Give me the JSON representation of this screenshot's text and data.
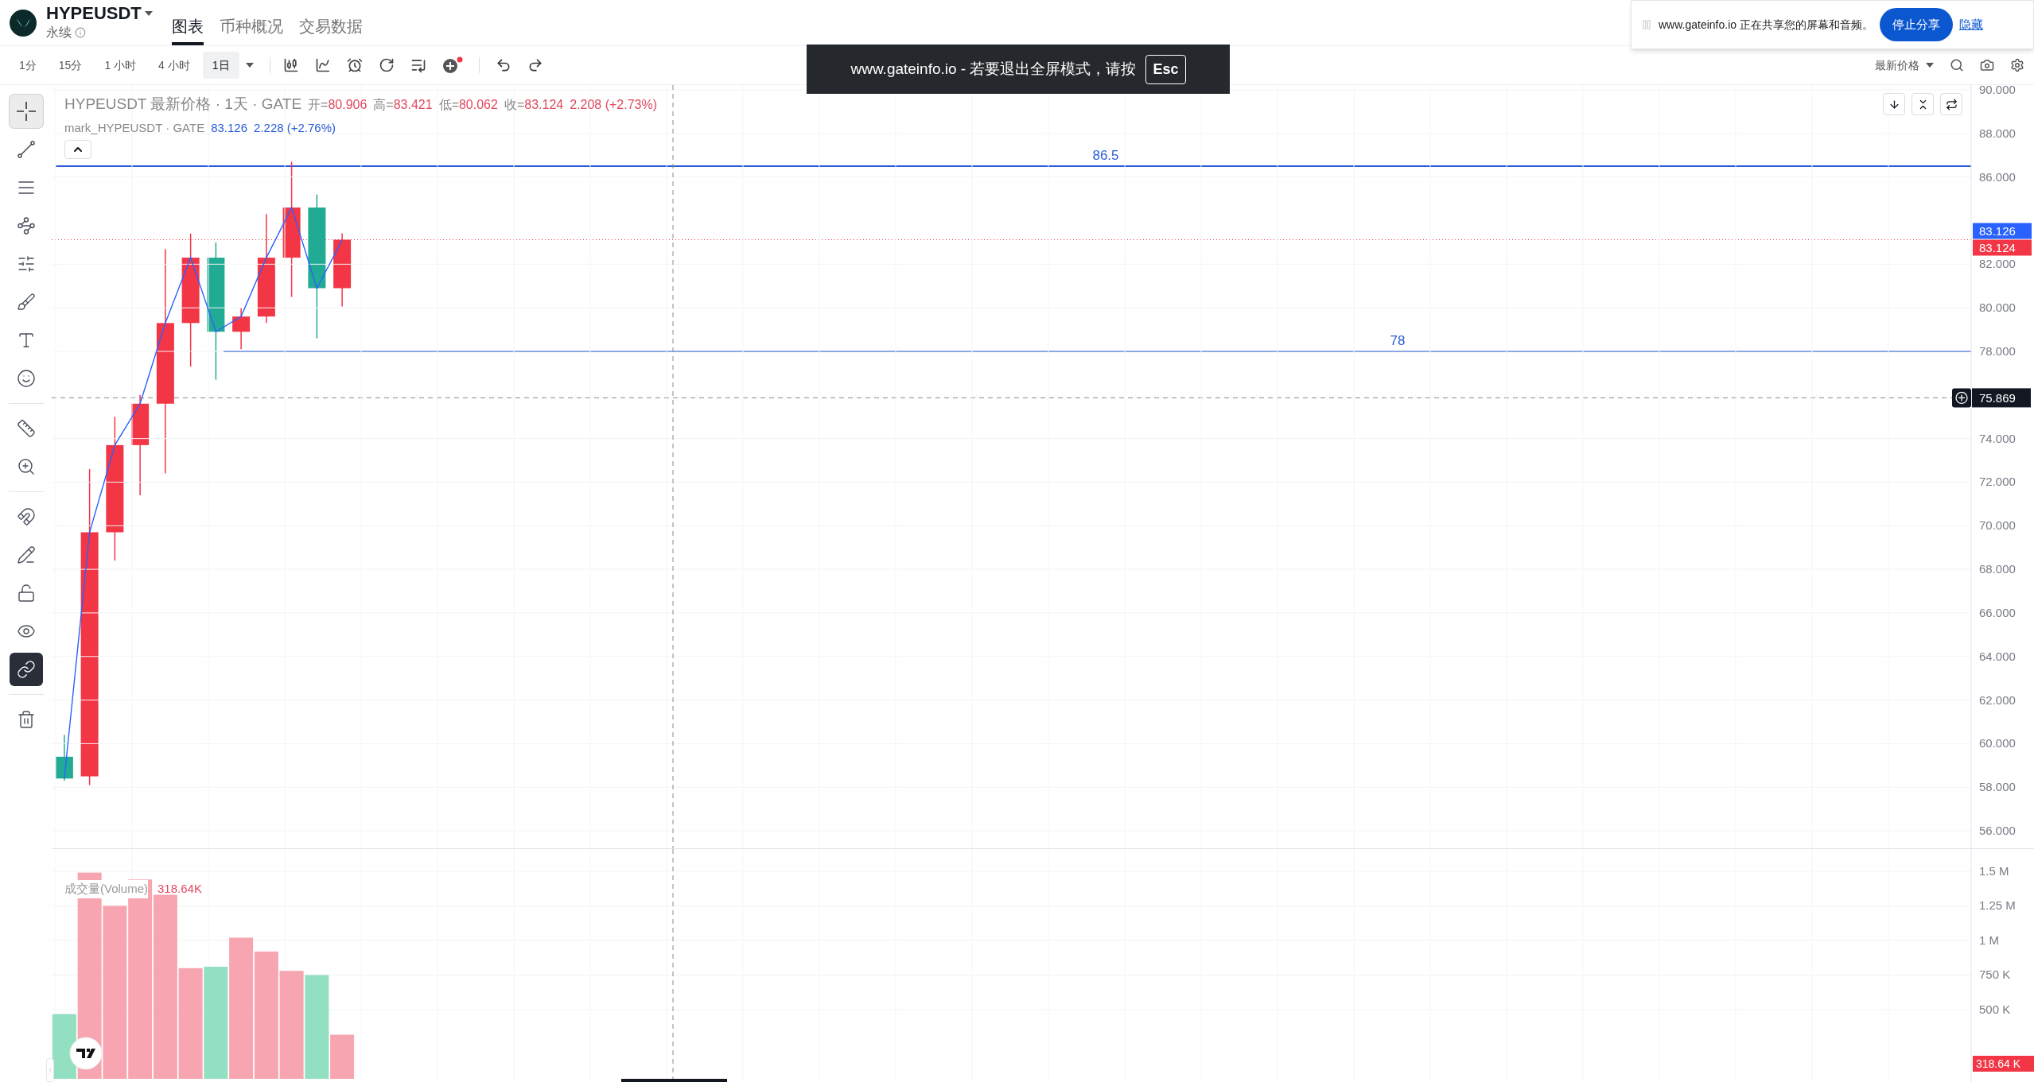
{
  "header": {
    "symbol": "HYPEUSDT",
    "subtitle": "永续",
    "tabs": [
      {
        "label": "图表",
        "selected": true
      },
      {
        "label": "币种概况",
        "selected": false
      },
      {
        "label": "交易数据",
        "selected": false
      }
    ]
  },
  "toolbar": {
    "intervals": [
      {
        "label": "1分",
        "selected": false
      },
      {
        "label": "15分",
        "selected": false
      },
      {
        "label": "1 小时",
        "selected": false
      },
      {
        "label": "4 小时",
        "selected": false
      },
      {
        "label": "1日",
        "selected": true
      }
    ],
    "price_source": "最新价格"
  },
  "fullscreen_notice": {
    "text": "www.gateinfo.io - 若要退出全屏模式，请按",
    "key": "Esc"
  },
  "share_bar": {
    "text": "www.gateinfo.io 正在共享您的屏幕和音频。",
    "stop_button": "停止分享",
    "hide_link": "隐藏"
  },
  "tools": [
    {
      "kind": "crosshair",
      "selected": true
    },
    {
      "kind": "line",
      "selected": false
    },
    {
      "kind": "hlines",
      "selected": false
    },
    {
      "kind": "pattern",
      "selected": false
    },
    {
      "kind": "fib",
      "selected": false
    },
    {
      "kind": "brush",
      "selected": false
    },
    {
      "kind": "text",
      "selected": false
    },
    {
      "kind": "emoji",
      "selected": false
    },
    {
      "kind": "ruler",
      "selected": false
    },
    {
      "kind": "zoom",
      "selected": false
    },
    {
      "kind": "magnet",
      "selected": false,
      "on": false
    },
    {
      "kind": "pencil-lock",
      "selected": false,
      "on": false
    },
    {
      "kind": "lock",
      "selected": false,
      "on": false
    },
    {
      "kind": "eye",
      "selected": false,
      "on": false
    },
    {
      "kind": "link",
      "selected": false,
      "on": true
    },
    {
      "kind": "trash",
      "selected": false
    }
  ],
  "legend": {
    "title": "HYPEUSDT 最新价格 · 1天 · GATE",
    "ohlc": [
      {
        "label": "开=",
        "value": "80.906"
      },
      {
        "label": "高=",
        "value": "83.421"
      },
      {
        "label": "低=",
        "value": "80.062"
      },
      {
        "label": "收=",
        "value": "83.124"
      }
    ],
    "change": "2.208 (+2.73%)",
    "mark": {
      "value": "83.126",
      "change": "2.228 (+2.76%)"
    }
  },
  "price_chart": {
    "levels": [
      {
        "label": "86.5"
      },
      {
        "label": "78"
      }
    ],
    "price_tags": [
      {
        "text": "83.126",
        "color": "#2962ff"
      },
      {
        "text": "83.124",
        "color": "#f23645"
      }
    ],
    "crosshair_price": "75.869",
    "chart_data": {
      "type": "line",
      "grid": true,
      "ylim": [
        55.2,
        90.22
      ],
      "categories": [
        null,
        null,
        null,
        null,
        null,
        null,
        null,
        null,
        null,
        null,
        null,
        null,
        null,
        null,
        null,
        null,
        null,
        null,
        null,
        null,
        null,
        null,
        null,
        null,
        null,
        null,
        null,
        null,
        null,
        null,
        null,
        null,
        null,
        null,
        null,
        null,
        null,
        null,
        null,
        null,
        null,
        null,
        null,
        null,
        null,
        null,
        null,
        null,
        null,
        null,
        null,
        null,
        null,
        null,
        null,
        null,
        null,
        null,
        null,
        null,
        null,
        null,
        null,
        null,
        null,
        null,
        null,
        null,
        null,
        null,
        null,
        null,
        null,
        null,
        null,
        null
      ],
      "yticks": [
        {
          "value": 90,
          "label": "90.000"
        },
        {
          "value": 88,
          "label": "88.000"
        },
        {
          "value": 86,
          "label": "86.000"
        },
        {
          "value": 82,
          "label": "82.000"
        },
        {
          "value": 80,
          "label": "80.000"
        },
        {
          "value": 78,
          "label": "78.000"
        },
        {
          "value": 74,
          "label": "74.000"
        },
        {
          "value": 72,
          "label": "72.000"
        },
        {
          "value": 70,
          "label": "70.000"
        },
        {
          "value": 68,
          "label": "68.000"
        },
        {
          "value": 66,
          "label": "66.000"
        },
        {
          "value": 64,
          "label": "64.000"
        },
        {
          "value": 62,
          "label": "62.000"
        },
        {
          "value": 60,
          "label": "60.000"
        },
        {
          "value": 58,
          "label": "58.000"
        },
        {
          "value": 56,
          "label": "56.000"
        }
      ],
      "series": [
        {
          "name": "mark_HYPEUSDT · GATE",
          "color": "#2962ff",
          "values": [
            58.4,
            69.7,
            73.7,
            75.6,
            79.3,
            82.3,
            78.9,
            79.6,
            82.3,
            84.6,
            80.9,
            83.1,
            null,
            null,
            null,
            null,
            null,
            null,
            null,
            null,
            null,
            null,
            null,
            null,
            null,
            null,
            null,
            null,
            null,
            null,
            null,
            null,
            null,
            null,
            null,
            null,
            null,
            null,
            null,
            null,
            null,
            null,
            null,
            null,
            null,
            null,
            null,
            null,
            null,
            null,
            null,
            null,
            null,
            null,
            null,
            null,
            null,
            null,
            null,
            null,
            null,
            null,
            null,
            null,
            null,
            null,
            null,
            null,
            null,
            null,
            null,
            null,
            null,
            null,
            null,
            null
          ]
        }
      ]
    }
  },
  "volume": {
    "title": "成交量(Volume)",
    "value": "318.64K",
    "tag": "318.64 K",
    "bars": [
      {
        "kind": "down"
      },
      {
        "kind": "up"
      },
      {
        "kind": "up"
      },
      {
        "kind": "up"
      },
      {
        "kind": "up"
      },
      {
        "kind": "up"
      },
      {
        "kind": "down"
      },
      {
        "kind": "up"
      },
      {
        "kind": "up"
      },
      {
        "kind": "up"
      },
      {
        "kind": "down"
      },
      {
        "kind": "up"
      }
    ],
    "chart_data": {
      "type": "bar",
      "grid": true,
      "ylim": [
        0,
        1660000
      ],
      "categories": [
        null,
        null,
        null,
        null,
        null,
        null,
        null,
        null,
        null,
        null,
        null,
        null,
        null,
        null,
        null,
        null,
        null,
        null,
        null,
        null,
        null,
        null,
        null,
        null,
        null,
        null,
        null,
        null,
        null,
        null,
        null,
        null,
        null,
        null,
        null,
        null,
        null,
        null,
        null,
        null,
        null,
        null,
        null,
        null,
        null,
        null,
        null,
        null,
        null,
        null,
        null,
        null,
        null,
        null,
        null,
        null,
        null,
        null,
        null,
        null,
        null,
        null,
        null,
        null,
        null,
        null,
        null,
        null,
        null,
        null,
        null,
        null,
        null,
        null,
        null,
        null
      ],
      "yticks": [
        {
          "value": 1500000,
          "label": "1.5 M"
        },
        {
          "value": 1250000,
          "label": "1.25 M"
        },
        {
          "value": 1000000,
          "label": "1 M"
        },
        {
          "value": 750000,
          "label": "750 K"
        },
        {
          "value": 500000,
          "label": "500 K"
        }
      ],
      "series": [
        {
          "values": [
            468000,
            1490000,
            1250000,
            1440000,
            1330000,
            800000,
            810000,
            1020000,
            920000,
            780000,
            750000,
            318640,
            null,
            null,
            null,
            null,
            null,
            null,
            null,
            null,
            null,
            null,
            null,
            null,
            null,
            null,
            null,
            null,
            null,
            null,
            null,
            null,
            null,
            null,
            null,
            null,
            null,
            null,
            null,
            null,
            null,
            null,
            null,
            null,
            null,
            null,
            null,
            null,
            null,
            null,
            null,
            null,
            null,
            null,
            null,
            null,
            null,
            null,
            null,
            null,
            null,
            null,
            null,
            null,
            null,
            null,
            null,
            null,
            null,
            null,
            null,
            null,
            null,
            null,
            null,
            null
          ]
        }
      ]
    }
  }
}
